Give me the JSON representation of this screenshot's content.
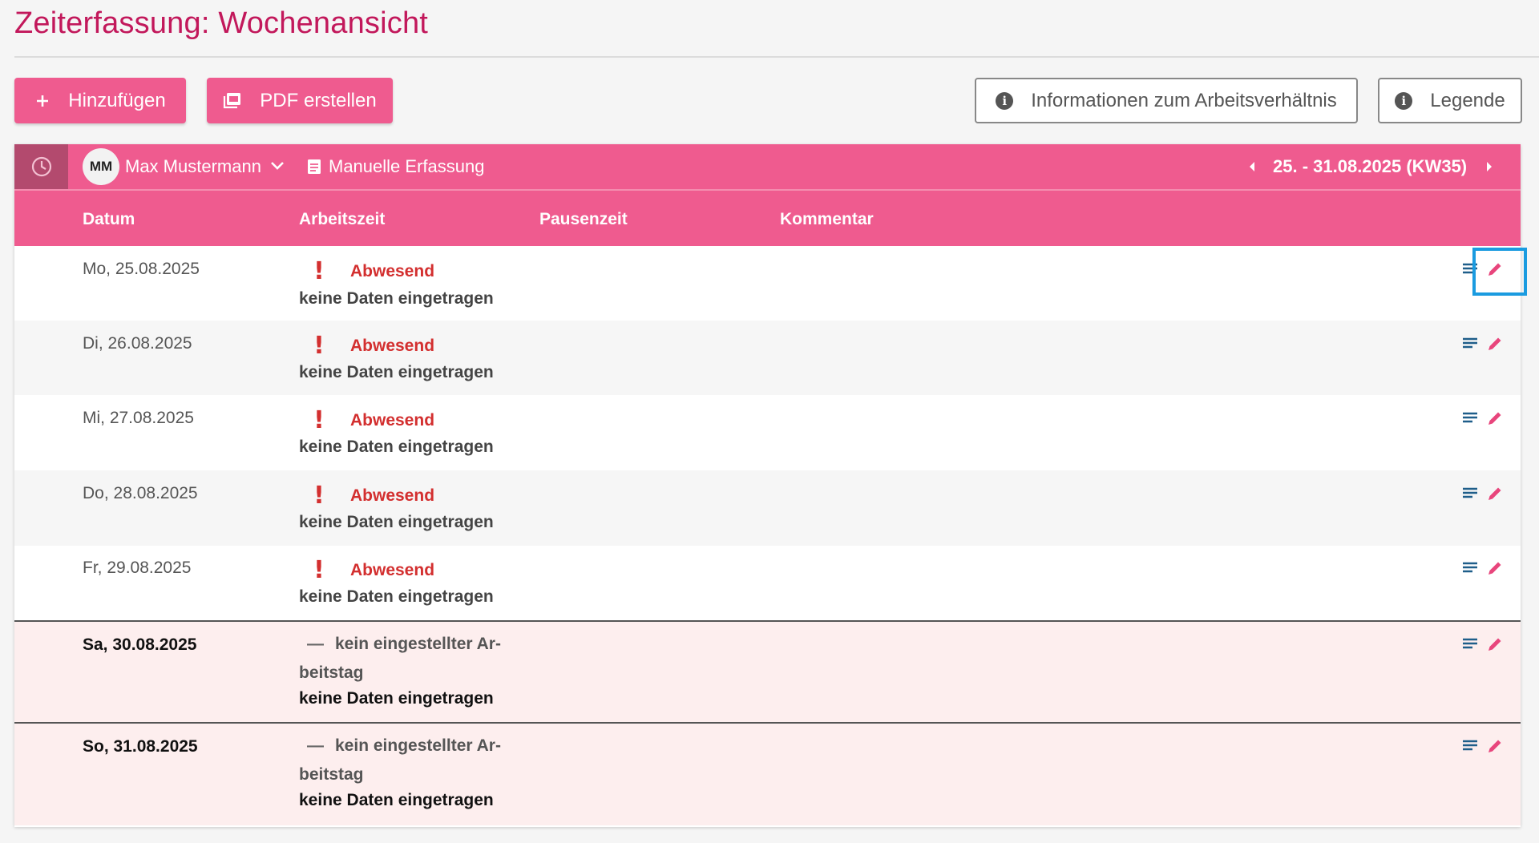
{
  "page": {
    "title": "Zeiterfassung: Wochenansicht",
    "accent": "#ef5b8f",
    "title_color": "#c2185b"
  },
  "actions": {
    "add_label": "Hinzufügen",
    "add_icon": "plus-icon",
    "pdf_label": "PDF erstellen",
    "pdf_icon": "pdf-icon",
    "employment_info_label": "Informationen zum Arbeitsverhältnis",
    "legend_label": "Legende",
    "info_icon": "info-icon"
  },
  "toolbar": {
    "clock_icon": "clock-icon",
    "avatar_initials": "MM",
    "user_name": "Max Mustermann",
    "manual_entry_label": "Manuelle Erfassung",
    "week_label": "25. - 31.08.2025 (KW35)"
  },
  "table": {
    "columns": [
      "Datum",
      "Arbeitszeit",
      "Pausenzeit",
      "Kommentar"
    ],
    "rows": [
      {
        "date": "Mo, 25.08.2025",
        "status": "Abwesend",
        "info": "keine Daten eingetragen"
      },
      {
        "date": "Di, 26.08.2025",
        "status": "Abwesend",
        "info": "keine Daten eingetragen"
      },
      {
        "date": "Mi, 27.08.2025",
        "status": "Abwesend",
        "info": "keine Daten eingetragen"
      },
      {
        "date": "Do, 28.08.2025",
        "status": "Abwesend",
        "info": "keine Daten eingetragen"
      },
      {
        "date": "Fr, 29.08.2025",
        "status": "Abwesend",
        "info": "keine Daten eingetragen"
      },
      {
        "date": "Sa, 30.08.2025",
        "status_line1": "kein eingestellter Ar-",
        "status_line2": "beitstag",
        "info": "keine Daten eingetragen"
      },
      {
        "date": "So, 31.08.2025",
        "status_line1": "kein eingestellter Ar-",
        "status_line2": "beitstag",
        "info": "keine Daten eingetragen"
      }
    ],
    "row_icons": [
      "notes-icon",
      "edit-pencil-icon"
    ]
  }
}
